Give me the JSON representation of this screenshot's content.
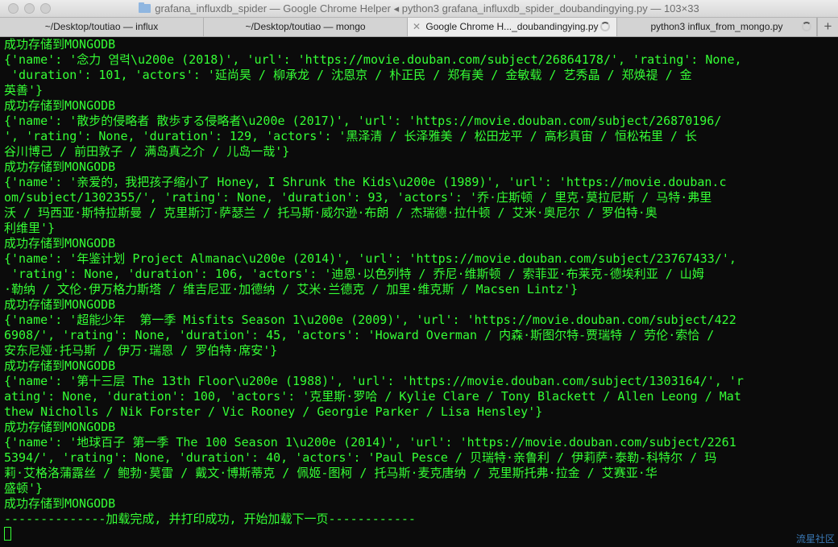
{
  "window": {
    "title": "grafana_influxdb_spider — Google Chrome Helper ◂ python3 grafana_influxdb_spider_doubandingying.py — 103×33"
  },
  "tabs": [
    {
      "label": "~/Desktop/toutiao — influx",
      "active": false
    },
    {
      "label": "~/Desktop/toutiao — mongo",
      "active": false
    },
    {
      "label": "Google Chrome H..._doubandingying.py",
      "active": true
    },
    {
      "label": "python3 influx_from_mongo.py",
      "active": false
    }
  ],
  "new_tab_label": "+",
  "terminal": {
    "lines": [
      "成功存储到MONGODB",
      "{'name': '念力 염력\\u200e (2018)', 'url': 'https://movie.douban.com/subject/26864178/', 'rating': None,",
      " 'duration': 101, 'actors': '延尚昊 / 柳承龙 / 沈恩京 / 朴正民 / 郑有美 / 金敏载 / 艺秀晶 / 郑焕禔 / 金",
      "英善'}",
      "成功存储到MONGODB",
      "{'name': '散步的侵略者 散歩する侵略者\\u200e (2017)', 'url': 'https://movie.douban.com/subject/26870196/",
      "', 'rating': None, 'duration': 129, 'actors': '黑泽清 / 长泽雅美 / 松田龙平 / 高杉真宙 / 恒松祐里 / 长",
      "谷川博己 / 前田敦子 / 满岛真之介 / 儿岛一哉'}",
      "成功存储到MONGODB",
      "{'name': '亲爱的，我把孩子缩小了 Honey, I Shrunk the Kids\\u200e (1989)', 'url': 'https://movie.douban.c",
      "om/subject/1302355/', 'rating': None, 'duration': 93, 'actors': '乔·庄斯顿 / 里克·莫拉尼斯 / 马特·弗里",
      "沃 / 玛西亚·斯特拉斯曼 / 克里斯汀·萨瑟兰 / 托马斯·威尔逊·布朗 / 杰瑞德·拉什顿 / 艾米·奥尼尔 / 罗伯特·奥",
      "利维里'}",
      "成功存储到MONGODB",
      "{'name': '年鉴计划 Project Almanac\\u200e (2014)', 'url': 'https://movie.douban.com/subject/23767433/',",
      " 'rating': None, 'duration': 106, 'actors': '迪恩·以色列特 / 乔尼·维斯顿 / 索菲亚·布莱克-德埃利亚 / 山姆",
      "·勒纳 / 文伦·伊万格力斯塔 / 维吉尼亚·加德纳 / 艾米·兰德克 / 加里·维克斯 / Macsen Lintz'}",
      "成功存储到MONGODB",
      "{'name': '超能少年  第一季 Misfits Season 1\\u200e (2009)', 'url': 'https://movie.douban.com/subject/422",
      "6908/', 'rating': None, 'duration': 45, 'actors': 'Howard Overman / 内森·斯图尔特-贾瑞特 / 劳伦·索恰 /",
      "安东尼娅·托马斯 / 伊万·瑞恩 / 罗伯特·席安'}",
      "成功存储到MONGODB",
      "{'name': '第十三层 The 13th Floor\\u200e (1988)', 'url': 'https://movie.douban.com/subject/1303164/', 'r",
      "ating': None, 'duration': 100, 'actors': '克里斯·罗哈 / Kylie Clare / Tony Blackett / Allen Leong / Mat",
      "thew Nicholls / Nik Forster / Vic Rooney / Georgie Parker / Lisa Hensley'}",
      "成功存储到MONGODB",
      "{'name': '地球百子 第一季 The 100 Season 1\\u200e (2014)', 'url': 'https://movie.douban.com/subject/2261",
      "5394/', 'rating': None, 'duration': 40, 'actors': 'Paul Pesce / 贝瑞特·亲鲁利 / 伊莉萨·泰勒-科特尔 / 玛",
      "莉·艾格洛蒲露丝 / 鲍勃·莫雷 / 戴文·博斯蒂克 / 佩姬-图柯 / 托马斯·麦克唐纳 / 克里斯托弗·拉金 / 艾赛亚·华",
      "盛顿'}",
      "成功存储到MONGODB",
      "--------------加载完成, 并打印成功, 开始加载下一页------------"
    ]
  },
  "watermark": "流星社区",
  "colors": {
    "terminal_bg": "#0b0b0b",
    "terminal_text": "#35ff35",
    "watermark": "#3a78b5"
  }
}
